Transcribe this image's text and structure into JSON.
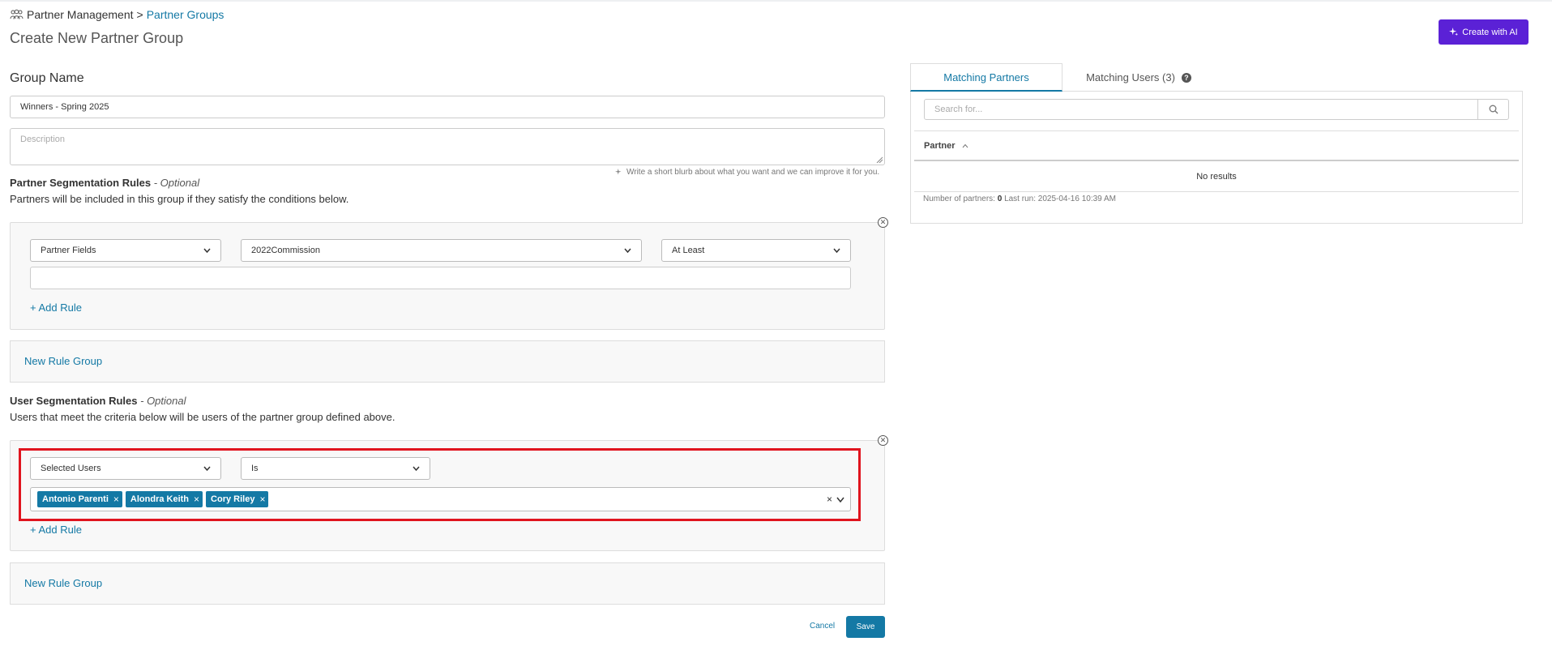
{
  "breadcrumb": {
    "root": "Partner Management",
    "separator": ">",
    "current": "Partner Groups"
  },
  "page": {
    "title": "Create New Partner Group"
  },
  "actions": {
    "create_with_ai": "Create with AI"
  },
  "form": {
    "group_name_label": "Group Name",
    "group_name_value": "Winners - Spring 2025",
    "description_placeholder": "Description",
    "ai_hint": "Write a short blurb about what you want and we can improve it for you."
  },
  "partner_rules": {
    "title": "Partner Segmentation Rules",
    "optional": "- Optional",
    "description": "Partners will be included in this group if they satisfy the conditions below.",
    "rule": {
      "field_type": "Partner Fields",
      "field": "2022Commission",
      "operator": "At Least",
      "value": ""
    },
    "add_rule": "+ Add Rule",
    "new_rule_group": "New Rule Group"
  },
  "user_rules": {
    "title": "User Segmentation Rules",
    "optional": "- Optional",
    "description": "Users that meet the criteria below will be users of the partner group defined above.",
    "rule": {
      "field_type": "Selected Users",
      "operator": "Is"
    },
    "selected_users": [
      "Antonio Parenti",
      "Alondra Keith",
      "Cory Riley"
    ],
    "add_rule": "+ Add Rule",
    "new_rule_group": "New Rule Group"
  },
  "footer": {
    "cancel": "Cancel",
    "save": "Save"
  },
  "right_panel": {
    "tabs": [
      {
        "label": "Matching Partners",
        "active": true
      },
      {
        "label": "Matching Users (3)",
        "active": false
      }
    ],
    "help_glyph": "?",
    "search_placeholder": "Search for...",
    "table": {
      "column": "Partner",
      "empty": "No results",
      "footer_label": "Number of partners:",
      "partner_count": "0",
      "last_run_label": "Last run:",
      "last_run": "2025-04-16 10:39 AM"
    }
  },
  "icons": [
    "users-icon",
    "sparkle-icon",
    "search-icon",
    "close-circle-icon",
    "chevron-down-icon",
    "chevron-up-icon",
    "help-icon"
  ],
  "colors": {
    "accent": "#1479a5",
    "ai_button": "#5b21d6",
    "highlight": "#e0141e"
  }
}
